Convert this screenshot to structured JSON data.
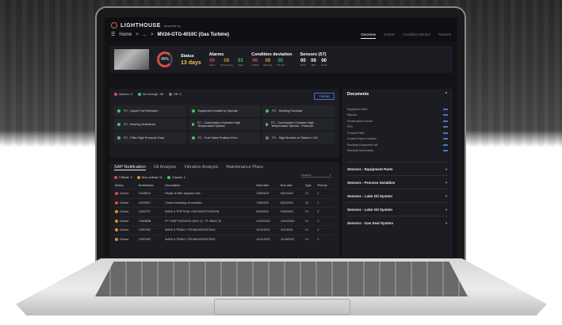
{
  "app": {
    "brand": "LIGHTHOUSE",
    "powered_by": "powered by",
    "breadcrumb_home": "Home",
    "breadcrumb_sep": ">",
    "breadcrumb_mid": "...",
    "asset_title": "MV24-GTG-4010C (Gas Turbine)"
  },
  "nav": {
    "tabs": [
      "Overview",
      "Events",
      "Condition Monitor",
      "Reports"
    ]
  },
  "kpi": {
    "gauge_value": "45%",
    "status_label": "Status",
    "status_value": "13 days",
    "alarms_label": "Alarms",
    "alarms": [
      {
        "value": "00",
        "label": "Alarm"
      },
      {
        "value": "08",
        "label": "Trip warning"
      },
      {
        "value": "01",
        "label": "Clear"
      }
    ],
    "deviation_label": "Condition deviation",
    "deviation": [
      {
        "value": "00",
        "label": "Critical"
      },
      {
        "value": "08",
        "label": "Warning"
      },
      {
        "value": "01",
        "label": "Normal"
      }
    ],
    "sensors_label": "Sensors (57)",
    "sensors": [
      {
        "value": "00",
        "label": "Alarm"
      },
      {
        "value": "00",
        "label": "Bad"
      },
      {
        "value": "00",
        "label": "Good"
      }
    ]
  },
  "alarms_panel": {
    "legend": [
      "Alarms: 3",
      "No change: 38",
      "Off: 3"
    ],
    "button": "TREND",
    "cells": [
      "FV - Liquid Fuel Selection",
      "Equipment Unable to Operate",
      "FC - Starting Overload",
      "FC - Bearing Undefined",
      "FC - Combustion Chamber High Temperature Spread",
      "FC - Combustion Chamber High Temperature Spread - Pressure",
      "FC - Filter High Pressure Drop",
      "FC - Fuel Valve Position Error",
      "FC - High Number of Starts in 12h"
    ]
  },
  "documents": {
    "title": "Documents",
    "items": [
      "Equipment P&ID",
      "Manual",
      "Performance Curves",
      "PFD",
      "Process P&ID",
      "Crucial Project Location",
      "Electrical Equipment List",
      "Electrical Schematics"
    ]
  },
  "sensors_sections": [
    "Sensors - Equipment Parts",
    "Sensors - Process Variables",
    "Sensors - Lube Oil System",
    "Sensors - Lube Oil System",
    "Sensors - Gas Seal System"
  ],
  "sap": {
    "tabs": [
      "SAP Notification",
      "Oil Analysis",
      "Vibration Analysis",
      "Maintenance Plans"
    ],
    "legend": [
      "Critical: 2",
      "Non-critical: 11",
      "Closed: 1"
    ],
    "search_placeholder": "Search",
    "columns": [
      "Status",
      "Notification",
      "Description",
      "Start date",
      "End date",
      "Type",
      "Priority"
    ],
    "rows": [
      [
        "Closed",
        "11208974",
        "Repair oil filter (bypass) tube",
        "7/28/2023",
        "8/01/2023",
        "C1",
        "1"
      ],
      [
        "Closed",
        "11209547",
        "Check lubricating oil condition",
        "7/28/2023",
        "8/02/2023",
        "C2",
        "1"
      ],
      [
        "Closed",
        "11109737",
        "MAKE A TRIP DUAL GAS INVESTIGATION",
        "6/30/2023",
        "6/30/2023",
        "C1",
        "2"
      ],
      [
        "Closed",
        "10946836",
        "FF PUMP ONGOING (GEO 1) - FT-2804C-10",
        "12/22/2022",
        "12/22/2022",
        "C1",
        "2"
      ],
      [
        "Closed",
        "10907967",
        "MAKE A TRAIN 1 TROUBLESHOOTING",
        "10/11/2022",
        "4/11/2023",
        "C1",
        "2"
      ],
      [
        "Closed",
        "10907967",
        "MAKE A TRAIN 1 TROUBLESHOOTING",
        "10/11/2022",
        "11/18/2022",
        "C1",
        "2"
      ]
    ]
  }
}
